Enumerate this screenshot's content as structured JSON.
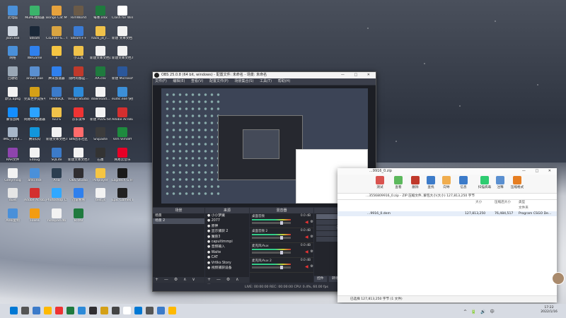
{
  "desktop": {
    "icons": [
      {
        "label": "此电脑",
        "color": "#4a90d9"
      },
      {
        "label": "MuMu模拟器",
        "color": "#3bb36b"
      },
      {
        "label": "Bongo Cat Mver",
        "color": "#e6a23c"
      },
      {
        "label": "RimWorld",
        "color": "#6a5a48"
      },
      {
        "label": "每本.xlsx",
        "color": "#1f7a3e"
      },
      {
        "label": "Clash for Windows",
        "color": "#ffffff"
      },
      {
        "label": "json.exe",
        "color": "#cfd6e0"
      },
      {
        "label": "Steam",
        "color": "#1b2838"
      },
      {
        "label": "Counter-S... Global Off...",
        "color": "#d9a441"
      },
      {
        "label": "Steam++",
        "color": "#3a7bd5"
      },
      {
        "label": "hack_jd_r...",
        "color": "#f0c24a"
      },
      {
        "label": "新建 文本文档 (2).txt",
        "color": "#f2f2f2"
      },
      {
        "label": "网络",
        "color": "#4a90d9"
      },
      {
        "label": "WeGame",
        "color": "#2f80ed"
      },
      {
        "label": "e",
        "color": "#f5c542"
      },
      {
        "label": "小工具",
        "color": "#f0c24a"
      },
      {
        "label": "新建文本文档(2).txt",
        "color": "#f2f2f2"
      },
      {
        "label": "新建文本文档.txt",
        "color": "#f2f2f2"
      },
      {
        "label": "回收站",
        "color": "#9aa7b5"
      },
      {
        "label": "aria2c.exe",
        "color": "#5a8fd0"
      },
      {
        "label": "腾讯加速器",
        "color": "#2f80ed"
      },
      {
        "label": "随时的都是...",
        "color": "#c0392b"
      },
      {
        "label": "AA.csv",
        "color": "#1f7a3e"
      },
      {
        "label": "新建 Microsoft ...",
        "color": "#2b579a"
      },
      {
        "label": "默认.apkg",
        "color": "#f2f2f2"
      },
      {
        "label": "完美世界竞技平台",
        "color": "#d4a017"
      },
      {
        "label": "HeidiSQL",
        "color": "#3c7bc9"
      },
      {
        "label": "Visual Studio Code",
        "color": "#2d8ad8"
      },
      {
        "label": "download...",
        "color": "#f2f2f2"
      },
      {
        "label": "eudic.exe 快捷方式",
        "color": "#3c8fd8"
      },
      {
        "label": "暴雪战网",
        "color": "#148eff"
      },
      {
        "label": "网易UU加速器",
        "color": "#2ba3ff"
      },
      {
        "label": "IELTS",
        "color": "#f0c24a"
      },
      {
        "label": "京东读书",
        "color": "#e33"
      },
      {
        "label": "新建 PLUS.txt",
        "color": "#f2f2f2"
      },
      {
        "label": "Adobe Acrobat DC",
        "color": "#d32f2f"
      },
      {
        "label": "IMG_0363...",
        "color": "#a7b6c8"
      },
      {
        "label": "腾讯QQ",
        "color": "#1296db"
      },
      {
        "label": "新建文本文档.txt",
        "color": "#f2f2f2"
      },
      {
        "label": "BIN音乐社区",
        "color": "#ff6b6b"
      },
      {
        "label": "Snipaste",
        "color": "#3c3c3c"
      },
      {
        "label": "Vim Vimdiff",
        "color": "#1e8a3e"
      },
      {
        "label": "RAR文件",
        "color": "#8e44ad"
      },
      {
        "label": "Edoug",
        "color": "#f2f2f2"
      },
      {
        "label": "SQLite",
        "color": "#3c7bc9"
      },
      {
        "label": "新建文本文档.txt",
        "color": "#f2f2f2"
      },
      {
        "label": "石墨",
        "color": "#333"
      },
      {
        "label": "网易云音乐",
        "color": "#e60026"
      },
      {
        "label": "Geeymiog",
        "color": "#f2f2f2"
      },
      {
        "label": "anki.exe",
        "color": "#4a90d9"
      },
      {
        "label": "Aria",
        "color": "#2c3e50"
      },
      {
        "label": "OBS Studio",
        "color": "#302e31"
      },
      {
        "label": "Potplayer",
        "color": "#f5c542"
      },
      {
        "label": "Logitech G HUB",
        "color": "#1a1a1a"
      },
      {
        "label": "duet",
        "color": "#e5e5e5"
      },
      {
        "label": "Adobe Acrobat DC",
        "color": "#d32f2f"
      },
      {
        "label": "Photoshop CS",
        "color": "#31a8ff"
      },
      {
        "label": "迅雷看看",
        "color": "#2f80ed"
      },
      {
        "label": "test.js",
        "color": "#f2f2f2"
      },
      {
        "label": "Epic Games Launcher",
        "color": "#222"
      },
      {
        "label": "Anki复制",
        "color": "#4a90d9"
      },
      {
        "label": "Foxea",
        "color": "#f39c12"
      },
      {
        "label": "notepad.db",
        "color": "#f2f2f2"
      },
      {
        "label": "B.csv",
        "color": "#1f7a3e"
      }
    ]
  },
  "obs": {
    "title": "OBS 25.0.8 (64 bit, windows) - 配置文件: 未命名 - 场景: 未命名",
    "window_controls": "— □ ✕",
    "menu": [
      "文件(F)",
      "编辑(E)",
      "查看(V)",
      "配置文件(P)",
      "场景集合(S)",
      "工具(T)",
      "帮助(H)"
    ],
    "docks": {
      "scenes_title": "场景",
      "sources_title": "来源",
      "mixer_title": "混音器",
      "controls_title": "控件"
    },
    "scenes": [
      "场景",
      "场景 2"
    ],
    "sources": [
      "小小梦魇",
      "2077",
      "原神",
      "显示捕获 2",
      "魔兽3",
      "capuitimmpi",
      "音频输入",
      "Waite",
      "CAT",
      "Vrtlks Story",
      "视频捕获设备"
    ],
    "mixer": [
      {
        "name": "桌面音频",
        "level": "0.0 dB"
      },
      {
        "name": "桌面音频 2",
        "level": "0.0 dB"
      },
      {
        "name": "麦克风/Aux",
        "level": "0.0 dB"
      },
      {
        "name": "麦克风/Aux 2",
        "level": "0.0 dB"
      }
    ],
    "controls": [
      "开始直播",
      "开始录制",
      "工作室模式",
      "设置",
      "退出"
    ],
    "bottom_tabs": [
      "控件",
      "转场特效"
    ],
    "status": "LIVE: 00:00:00    REC: 00:00:00    CPU: 0.4%, 60.00 fps",
    "footer_buttons": "+ — ⚙ ∧ ∨"
  },
  "bandizip": {
    "title": "...9916_0.zip",
    "window_controls": "— □ ✕",
    "toolbar": [
      "测试",
      "查看",
      "删除",
      "查找",
      "向导",
      "信息",
      "扫描病毒",
      "注释",
      "压缩格式"
    ],
    "path": "...3556809916_0.zip - ZIP 压缩文件, 解包大小(大小) 127,813,250 字节",
    "columns": {
      "size": "大小",
      "packed": "压缩后大小",
      "type": "类型"
    },
    "type_folder": "文件夹",
    "row": {
      "name": "...9916_0.dem",
      "size": "127,813,250",
      "packed": "76,484,517",
      "type": "Program CSGO De..."
    },
    "status": "已选择 127,813,250 字节 (1 文件)"
  },
  "taskbar": {
    "tray_icons": "^ 🔋 🔊 中",
    "time": "17:22",
    "date": "2022/1/16",
    "app_colors": [
      "#0078d4",
      "#555",
      "#3c7bc9",
      "#ffb900",
      "#e33",
      "#1f7a3e",
      "#2d8ad8",
      "#302e31",
      "#d4a017",
      "#444",
      "#fff"
    ]
  }
}
